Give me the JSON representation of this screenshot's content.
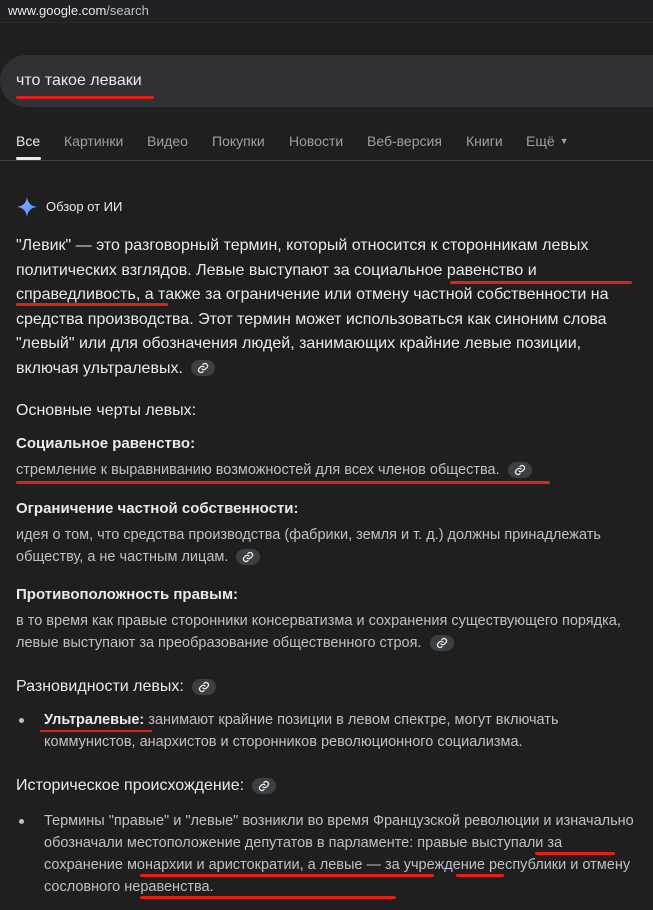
{
  "browser": {
    "url_domain": "www.google.com",
    "url_path": "/search"
  },
  "search": {
    "query": "что такое леваки"
  },
  "tabs": [
    "Все",
    "Картинки",
    "Видео",
    "Покупки",
    "Новости",
    "Веб-версия",
    "Книги",
    "Ещё"
  ],
  "ai_overview": {
    "title": "Обзор от ИИ",
    "intro": "\"Левик\" — это разговорный термин, который относится к сторонникам левых политических взглядов. Левые выступают за социальное равенство и справедливость, а также за ограничение или отмену частной собственности на средства производства. Этот термин может использоваться как синоним слова \"левый\" или для обозначения людей, занимающих крайние левые позиции, включая ультралевых.",
    "features_heading": "Основные черты левых:",
    "features": [
      {
        "title": "Социальное равенство:",
        "text": "стремление к выравниванию возможностей для всех членов общества."
      },
      {
        "title": "Ограничение частной собственности:",
        "text": "идея о том, что средства производства (фабрики, земля и т. д.) должны принадлежать обществу, а не частным лицам."
      },
      {
        "title": "Противоположность правым:",
        "text": "в то время как правые сторонники консерватизма и сохранения существующего порядка, левые выступают за преобразование общественного строя."
      }
    ],
    "varieties_heading": "Разновидности левых:",
    "varieties": [
      {
        "term": "Ультралевые:",
        "text": " занимают крайние позиции в левом спектре, могут включать коммунистов, анархистов и сторонников революционного социализма."
      }
    ],
    "history_heading": "Историческое происхождение:",
    "history": [
      {
        "text": "Термины \"правые\" и \"левые\" возникли во время Французской революции и изначально обозначали местоположение депутатов в парламенте: правые выступали за сохранение монархии и аристократии, а левые — за учреждение республики и отмену сословного неравенства."
      }
    ]
  },
  "colors": {
    "background": "#1f1f1f",
    "search_box": "#303134",
    "annotation": "#e0201b",
    "text": "#e8eaed",
    "muted": "#bdc1c6"
  }
}
